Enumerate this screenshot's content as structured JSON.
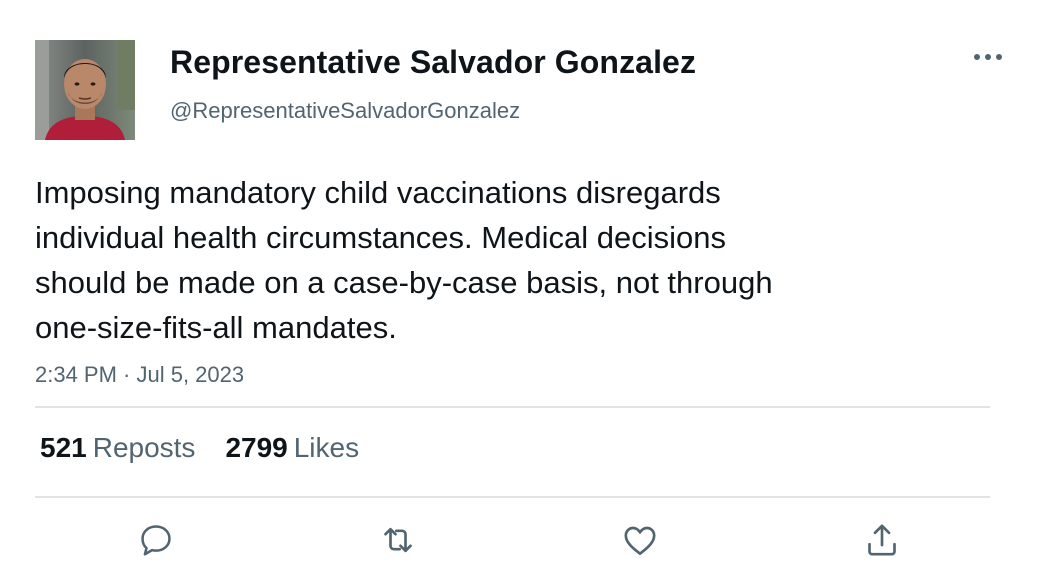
{
  "author": {
    "display_name": "Representative Salvador Gonzalez",
    "handle": "@RepresentativeSalvadorGonzalez",
    "avatar_icon": "profile-photo"
  },
  "tweet": {
    "text": "Imposing mandatory child vaccinations disregards\nindividual health circumstances. Medical decisions\nshould be made on a case-by-case basis, not through\none-size-fits-all mandates.",
    "timestamp": "2:34 PM · Jul 5, 2023"
  },
  "stats": {
    "reposts_count": "521",
    "reposts_label": "Reposts",
    "likes_count": "2799",
    "likes_label": "Likes"
  },
  "actions": {
    "icons": [
      "reply-icon",
      "retweet-icon",
      "like-icon",
      "share-icon"
    ],
    "more_icon": "more-options-icon"
  },
  "colors": {
    "text_primary": "#0f1419",
    "text_secondary": "#536471",
    "divider": "#e1e4e6",
    "icon": "#536471"
  }
}
